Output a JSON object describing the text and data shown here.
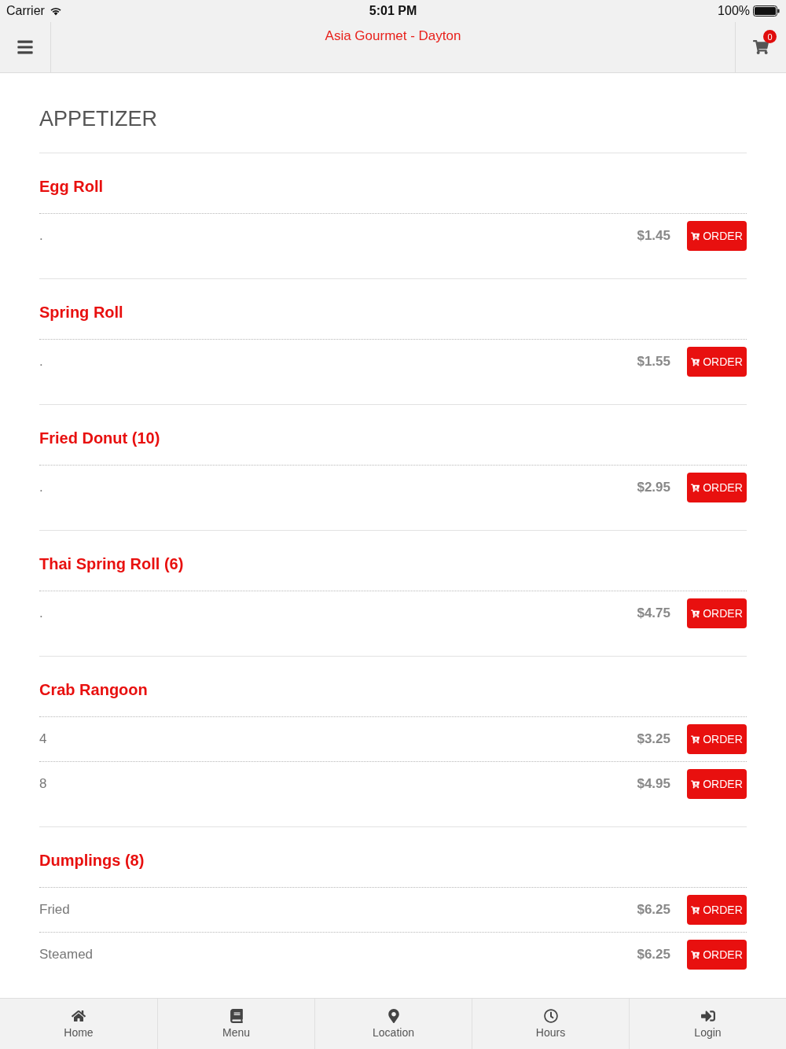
{
  "status_bar": {
    "carrier": "Carrier",
    "time": "5:01 PM",
    "battery": "100%"
  },
  "nav_bar": {
    "title": "Asia Gourmet - Dayton",
    "cart_count": "0"
  },
  "section": {
    "title": "APPETIZER",
    "items": [
      {
        "name": "Egg Roll",
        "options": [
          {
            "description": ".",
            "price": "$1.45",
            "button": "ORDER"
          }
        ]
      },
      {
        "name": "Spring Roll",
        "options": [
          {
            "description": ".",
            "price": "$1.55",
            "button": "ORDER"
          }
        ]
      },
      {
        "name": "Fried Donut (10)",
        "options": [
          {
            "description": ".",
            "price": "$2.95",
            "button": "ORDER"
          }
        ]
      },
      {
        "name": "Thai Spring Roll (6)",
        "options": [
          {
            "description": ".",
            "price": "$4.75",
            "button": "ORDER"
          }
        ]
      },
      {
        "name": "Crab Rangoon",
        "options": [
          {
            "description": "4",
            "price": "$3.25",
            "button": "ORDER"
          },
          {
            "description": "8",
            "price": "$4.95",
            "button": "ORDER"
          }
        ]
      },
      {
        "name": "Dumplings (8)",
        "options": [
          {
            "description": "Fried",
            "price": "$6.25",
            "button": "ORDER"
          },
          {
            "description": "Steamed",
            "price": "$6.25",
            "button": "ORDER"
          }
        ]
      }
    ]
  },
  "tab_bar": {
    "tabs": [
      {
        "label": "Home"
      },
      {
        "label": "Menu"
      },
      {
        "label": "Location"
      },
      {
        "label": "Hours"
      },
      {
        "label": "Login"
      }
    ]
  }
}
